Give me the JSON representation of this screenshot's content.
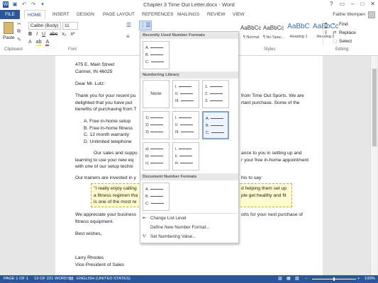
{
  "window": {
    "title": "Chapter 3 Time Out Letter.docx - Word",
    "controls": [
      "?",
      "▭",
      "–",
      "□",
      "✕"
    ]
  },
  "quick_access": [
    "save-icon",
    "undo-icon",
    "redo-icon",
    "customize-icon"
  ],
  "tabs": [
    "FILE",
    "HOME",
    "INSERT",
    "DESIGN",
    "PAGE LAYOUT",
    "REFERENCES",
    "MAILINGS",
    "REVIEW",
    "VIEW"
  ],
  "user": "Faithe Wempen",
  "ribbon": {
    "clipboard": {
      "paste": "Paste",
      "label": "Clipboard"
    },
    "font": {
      "name": "Calibri (Body)",
      "size": "11",
      "label": "Font"
    },
    "styles": {
      "label": "Styles",
      "items": [
        {
          "sample": "AaBbCcDc",
          "name": "¶ Normal"
        },
        {
          "sample": "AaBbCcDc",
          "name": "¶ No Spac..."
        },
        {
          "sample": "AaBbC",
          "name": "Heading 1"
        },
        {
          "sample": "AaBbCc",
          "name": "Heading 2"
        }
      ]
    },
    "editing": {
      "label": "Editing",
      "find": "Find",
      "replace": "Replace",
      "select": "Select"
    }
  },
  "dropdown": {
    "recent_header": "Recently Used Number Formats",
    "library_header": "Numbering Library",
    "document_header": "Document Number Formats",
    "none_label": "None",
    "recent": [
      [
        "A.",
        "B.",
        "C."
      ]
    ],
    "library": [
      [
        "1.",
        "2.",
        "3."
      ],
      [
        "1)",
        "2)",
        "3)"
      ],
      [
        "I.",
        "II.",
        "III."
      ],
      [
        "A.",
        "B.",
        "C."
      ],
      [
        "a)",
        "b)",
        "c)"
      ],
      [
        "a.",
        "b.",
        "c."
      ],
      [
        "i.",
        "ii.",
        "iii."
      ]
    ],
    "document": [
      [
        "A.",
        "B.",
        "C."
      ]
    ],
    "menu": [
      {
        "label": "Change List Level",
        "icon": "change-level-icon",
        "enabled": true
      },
      {
        "label": "Define New Number Format...",
        "icon": "",
        "enabled": true
      },
      {
        "label": "Set Numbering Value...",
        "icon": "set-value-icon",
        "enabled": true
      }
    ]
  },
  "document": {
    "lines": {
      "addr1": "475 E. Main Street",
      "addr2": "Carmel, IN 46025",
      "salutation": "Dear Mr. Lutz:",
      "p1a": "Thank you for your recent pu",
      "p1a_r": "from Time Out Sports. We are",
      "p1b": "delighted that you have put",
      "p1b_r": "rtant purchase.  Some of the",
      "p1c": "benefits of purchasing from T",
      "li1": "A.   Free in-home setup",
      "li2": "B.   Free in-home fitness",
      "li3": "C.   12 month warranty",
      "li4": "D.   Unlimited telephone",
      "p2a": "Our sales and suppo",
      "p2a_r": "ance to you in setting up and",
      "p2b": "learning to use your new eq",
      "p2b_r": "r your free in-home appointment",
      "p2c": "with one of our setup techni",
      "p3": "Our trainers are invested in y",
      "p3_r": "his to say:",
      "q1": "\"I really enjoy calling",
      "q1_r": "d helping them set up",
      "q2": "a fitness regimen tha",
      "q2_r": "ple get healthy and fit",
      "q3": "is one of the most re",
      "p4a": "We appreciate your business",
      "p4a_r": "orts for your next purchase of",
      "p4b": "fitness equipment.",
      "closing": "Best wishes,",
      "sig1": "Larry Rhodes",
      "sig2": "Vice President of Sales"
    }
  },
  "status": {
    "page": "PAGE 1 OF 1",
    "words": "19 OF 221 WORDS",
    "language": "ENGLISH (UNITED STATES)",
    "zoom": "100%"
  },
  "colors": {
    "accent": "#2b579a",
    "highlight": "#fff59d"
  }
}
